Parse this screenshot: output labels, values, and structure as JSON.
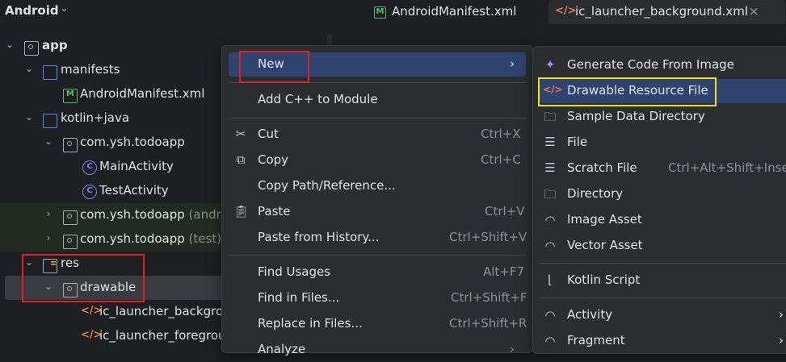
{
  "project_panel": {
    "title": "Android",
    "tree": [
      {
        "label": "app",
        "bold": true
      },
      {
        "label": "manifests"
      },
      {
        "label": "AndroidManifest.xml"
      },
      {
        "label": "kotlin+java"
      },
      {
        "label": "com.ysh.todoapp"
      },
      {
        "label": "MainActivity"
      },
      {
        "label": "TestActivity"
      },
      {
        "label": "com.ysh.todoapp",
        "suffix": "(andro"
      },
      {
        "label": "com.ysh.todoapp",
        "suffix": "(test)"
      },
      {
        "label": "res"
      },
      {
        "label": "drawable"
      },
      {
        "label": "ic_launcher_backgrou"
      },
      {
        "label": "ic_launcher_foregrou"
      }
    ]
  },
  "editor_tabs": [
    {
      "label": "AndroidManifest.xml"
    },
    {
      "label": "ic_launcher_background.xml",
      "close": "×"
    }
  ],
  "context_menu": {
    "items": [
      {
        "label": "New",
        "arrow": "›"
      },
      {
        "label": "Add C++ to Module"
      },
      {
        "label": "Cut",
        "shortcut": "Ctrl+X"
      },
      {
        "label": "Copy",
        "shortcut": "Ctrl+C"
      },
      {
        "label": "Copy Path/Reference..."
      },
      {
        "label": "Paste",
        "shortcut": "Ctrl+V"
      },
      {
        "label": "Paste from History...",
        "shortcut": "Ctrl+Shift+V"
      },
      {
        "label": "Find Usages",
        "shortcut": "Alt+F7"
      },
      {
        "label": "Find in Files...",
        "shortcut": "Ctrl+Shift+F"
      },
      {
        "label": "Replace in Files...",
        "shortcut": "Ctrl+Shift+R"
      },
      {
        "label": "Analyze",
        "arrow": "›"
      }
    ]
  },
  "submenu": {
    "items": [
      {
        "label": "Generate Code From Image"
      },
      {
        "label": "Drawable Resource File"
      },
      {
        "label": "Sample Data Directory"
      },
      {
        "label": "File"
      },
      {
        "label": "Scratch File",
        "shortcut": "Ctrl+Alt+Shift+Inser"
      },
      {
        "label": "Directory"
      },
      {
        "label": "Image Asset"
      },
      {
        "label": "Vector Asset"
      },
      {
        "label": "Kotlin Script"
      },
      {
        "label": "Activity",
        "arrow": "›"
      },
      {
        "label": "Fragment",
        "arrow": "›"
      }
    ]
  },
  "colors": {
    "highlight": "#e0212b",
    "selected_box": "#f0e020",
    "accent": "#2e436e"
  }
}
